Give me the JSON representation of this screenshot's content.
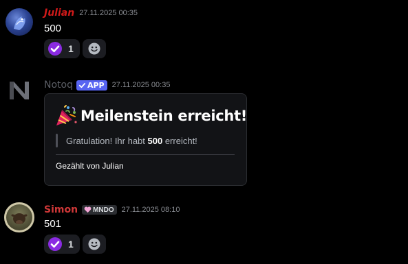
{
  "messages": [
    {
      "author": "Julian",
      "timestamp": "27.11.2025 00:35",
      "content": "500",
      "reactions": [
        {
          "emoji": "check-purple-icon",
          "count": "1"
        }
      ]
    },
    {
      "author": "Notoq",
      "badge": "APP",
      "timestamp": "27.11.2025 00:35",
      "embed": {
        "title": "Meilenstein erreicht!",
        "quote_prefix": "Gratulation! Ihr habt ",
        "quote_value": "500",
        "quote_suffix": " erreicht!",
        "footer": "Gezählt von Julian"
      }
    },
    {
      "author": "Simon",
      "guild_tag": "MNDO",
      "timestamp": "27.11.2025 08:10",
      "content": "501",
      "reactions": [
        {
          "emoji": "check-purple-icon",
          "count": "1"
        }
      ]
    }
  ],
  "colors": {
    "background": "#000000",
    "julian_name": "#d01a1a",
    "simon_name": "#d03838",
    "app_badge": "#5865f2",
    "reaction_bg": "#1c1d22",
    "embed_bg": "#121316",
    "check_emoji": "#8a2be2"
  }
}
